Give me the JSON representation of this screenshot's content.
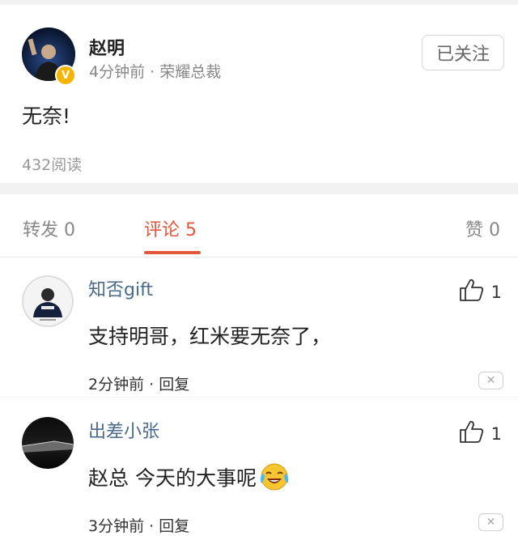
{
  "post": {
    "author": "赵明",
    "time": "4分钟前",
    "dot": "·",
    "title": "荣耀总裁",
    "badge": "V",
    "follow_label": "已关注",
    "text": "无奈!",
    "reads": "432阅读"
  },
  "tabs": [
    {
      "label": "转发",
      "count": "0"
    },
    {
      "label": "评论",
      "count": "5"
    },
    {
      "label": "赞",
      "count": "0"
    }
  ],
  "active_tab": "评论",
  "comments": [
    {
      "name": "知否gift",
      "likes": "1",
      "text": "支持明哥，红米要无奈了，",
      "time": "2分钟前",
      "dot": "·",
      "reply": "回复",
      "emoji": null
    },
    {
      "name": "出差小张",
      "likes": "1",
      "text": "赵总 今天的大事呢",
      "time": "3分钟前",
      "dot": "·",
      "reply": "回复",
      "emoji": "crying-laughing-emoji"
    }
  ],
  "colors": {
    "accent": "#e3573d",
    "name_link": "#4a6a8a",
    "badge": "#f4b400"
  }
}
